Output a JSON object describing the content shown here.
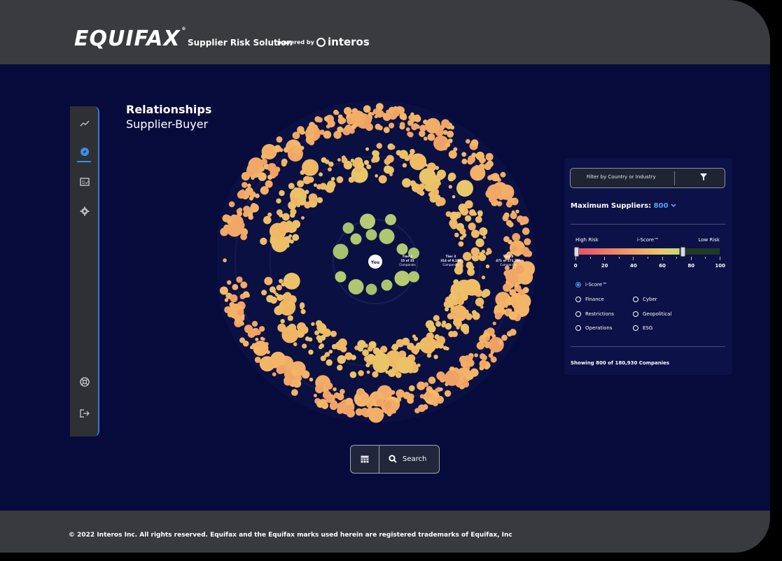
{
  "header": {
    "brand": "EQUIFAX",
    "product": "Supplier Risk Solution",
    "powered_by": "powered by",
    "partner": "interos"
  },
  "sidebar": {
    "items": [
      {
        "icon": "trend-icon",
        "active": false
      },
      {
        "icon": "compass-icon",
        "active": true
      },
      {
        "icon": "report-icon",
        "active": false
      },
      {
        "icon": "gear-icon",
        "active": false
      },
      {
        "icon": "support-icon",
        "active": false
      },
      {
        "icon": "logout-icon",
        "active": false
      }
    ]
  },
  "page": {
    "title": "Relationships",
    "subtitle": "Supplier-Buyer"
  },
  "viz": {
    "center_label": "You",
    "tiers": [
      {
        "name": "Tier 1",
        "shown": "15",
        "of": "of",
        "total": "35",
        "unit": "Companies"
      },
      {
        "name": "Tier 2",
        "shown": "314",
        "of": "of",
        "total": "9,194",
        "unit": "Companies"
      },
      {
        "name": "Tier 3",
        "shown": "471",
        "of": "of",
        "total": "171,701",
        "unit": "Companies"
      }
    ],
    "colors": {
      "tier1": "#b9cf76",
      "tier2": "#f2b264",
      "tier3": "#f4ba67",
      "accent": "#f0a065"
    }
  },
  "filter": {
    "label": "Filter by Country or Industry",
    "icon": "filter-icon"
  },
  "max_suppliers": {
    "label": "Maximum Suppliers:",
    "value": "800"
  },
  "risk_scale": {
    "high": "High Risk",
    "metric": "i-Score™",
    "low": "Low Risk",
    "ticks": [
      "0",
      "20",
      "40",
      "60",
      "80",
      "100"
    ],
    "range": [
      0,
      74
    ]
  },
  "radios": [
    {
      "label": "i-Score™",
      "checked": true
    },
    {
      "label": "Finance",
      "checked": false
    },
    {
      "label": "Restrictions",
      "checked": false
    },
    {
      "label": "Operations",
      "checked": false
    },
    {
      "label": "Cyber",
      "checked": false
    },
    {
      "label": "Geopolitical",
      "checked": false
    },
    {
      "label": "ESG",
      "checked": false
    }
  ],
  "showing": "Showing 800 of 180,930 Companies",
  "bottom_bar": {
    "search_label": "Search"
  },
  "footer": {
    "copyright": "© 2022 Interos Inc. All rights reserved. Equifax and the Equifax marks used herein are registered trademarks of Equifax, Inc"
  }
}
